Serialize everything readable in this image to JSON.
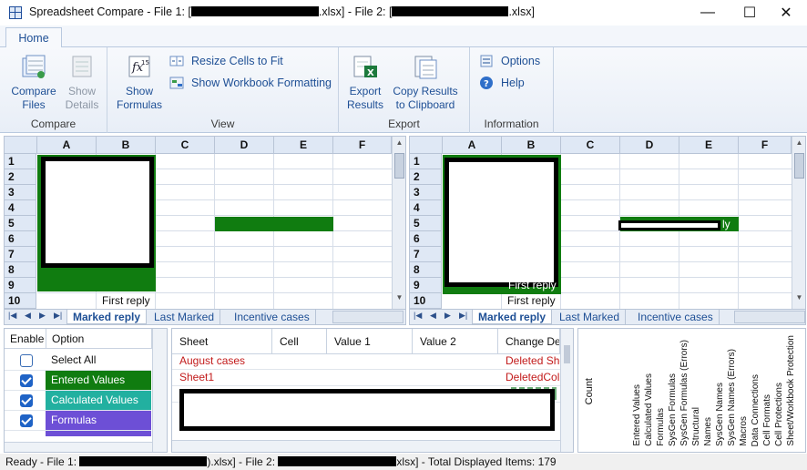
{
  "window": {
    "title_prefix": "Spreadsheet Compare - File 1: [",
    "title_file1_tail": ".xlsx]",
    "title_mid": " - File 2: [",
    "title_file2_tail": ".xlsx]",
    "minimize": "—",
    "maximize": "☐",
    "close": "✕"
  },
  "ribbon": {
    "tab_home": "Home",
    "groups": {
      "compare": {
        "label": "Compare",
        "compare_files": "Compare Files",
        "show_details": "Show Details"
      },
      "view": {
        "label": "View",
        "show_formulas": "Show Formulas",
        "resize_cells": "Resize Cells to Fit",
        "show_workbook_formatting": "Show Workbook Formatting"
      },
      "export": {
        "label": "Export",
        "export_results": "Export Results",
        "copy_results": "Copy Results to Clipboard"
      },
      "information": {
        "label": "Information",
        "options": "Options",
        "help": "Help"
      }
    }
  },
  "grid": {
    "columns": [
      "A",
      "B",
      "C",
      "D",
      "E",
      "F"
    ],
    "rows": [
      "1",
      "2",
      "3",
      "4",
      "5",
      "6",
      "7",
      "8",
      "9",
      "10"
    ],
    "left_cell_text": "First reply",
    "right_cell_text_row9": "First reply",
    "right_cell_text_row10": "First reply",
    "right_partial_text": "ly",
    "sheet_tabs": [
      "Marked reply",
      "Last Marked",
      "Incentive cases"
    ]
  },
  "options_panel": {
    "header_enable": "Enable",
    "header_option": "Option",
    "items": [
      {
        "label": "Select All",
        "checked": false,
        "color": "#ffffff",
        "text_color": "#111111"
      },
      {
        "label": "Entered Values",
        "checked": true,
        "color": "#107c10",
        "text_color": "#ffffff"
      },
      {
        "label": "Calculated Values",
        "checked": true,
        "color": "#22b0a0",
        "text_color": "#ffffff"
      },
      {
        "label": "Formulas",
        "checked": true,
        "color": "#6d4fd6",
        "text_color": "#ffffff"
      }
    ]
  },
  "results_panel": {
    "headers": [
      "Sheet",
      "Cell",
      "Value 1",
      "Value 2",
      "Change Des"
    ],
    "rows": [
      {
        "sheet": "August cases",
        "change": "Deleted She"
      },
      {
        "sheet": "Sheet1",
        "change": "DeletedColu"
      }
    ]
  },
  "count_panel": {
    "count_label": "Count",
    "categories": [
      "Entered Values",
      "Calculated Values",
      "Formulas",
      "SysGen Formulas",
      "SysGen Formulas (Errors)",
      "Structural",
      "Names",
      "SysGen Names",
      "SysGen Names (Errors)",
      "Macros",
      "Data Connections",
      "Cell Formats",
      "Cell Protections",
      "Sheet/Workbook Protection"
    ]
  },
  "status": {
    "prefix": "Ready - File 1: ",
    "file1_tail": ").xlsx]",
    "mid": " - File 2: ",
    "file2_tail": "xlsx]",
    "total": " - Total Displayed Items: 179"
  }
}
